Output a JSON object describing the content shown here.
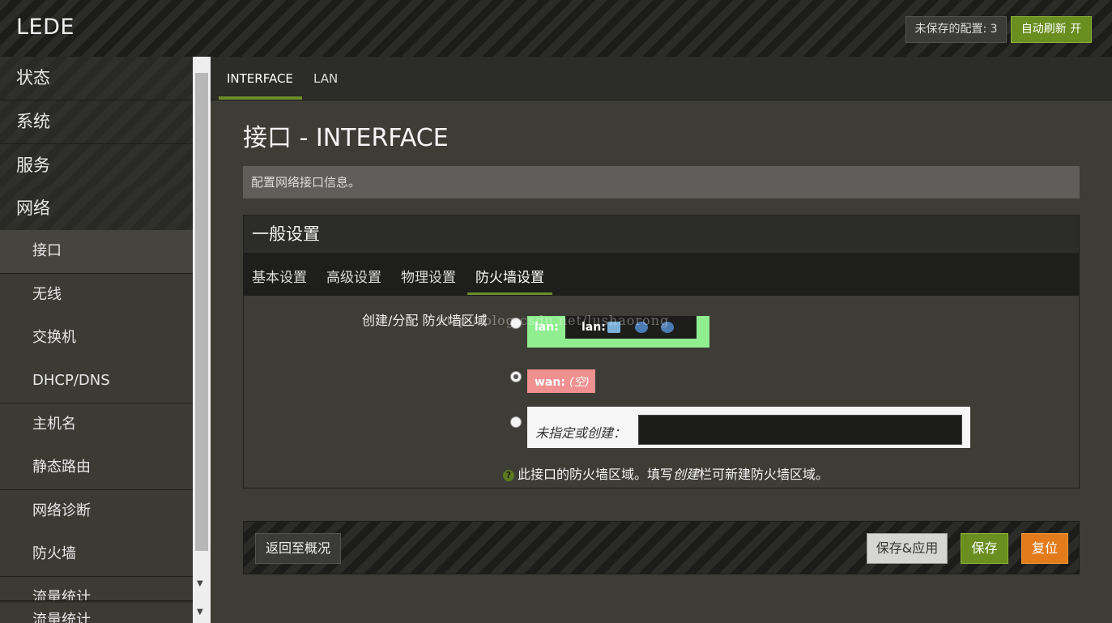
{
  "header": {
    "brand": "LEDE",
    "unsaved_label": "未保存的配置: 3",
    "autorefresh_label": "自动刷新 开"
  },
  "sidebar": {
    "items": [
      {
        "label": "状态",
        "level": "top"
      },
      {
        "label": "系统",
        "level": "top"
      },
      {
        "label": "服务",
        "level": "top"
      },
      {
        "label": "网络",
        "level": "top"
      },
      {
        "label": "接口",
        "level": "sub",
        "active": true
      },
      {
        "label": "无线",
        "level": "sub"
      },
      {
        "label": "交换机",
        "level": "sub"
      },
      {
        "label": "DHCP/DNS",
        "level": "sub"
      },
      {
        "label": "主机名",
        "level": "sub"
      },
      {
        "label": "静态路由",
        "level": "sub"
      },
      {
        "label": "网络诊断",
        "level": "sub"
      },
      {
        "label": "防火墙",
        "level": "sub"
      },
      {
        "label": "流量统计",
        "level": "sub"
      },
      {
        "label": "流量统计",
        "level": "sub"
      }
    ]
  },
  "tabs": [
    {
      "label": "INTERFACE",
      "active": true
    },
    {
      "label": "LAN",
      "active": false
    }
  ],
  "page": {
    "title": "接口 - INTERFACE",
    "description": "配置网络接口信息。"
  },
  "section": {
    "title": "一般设置",
    "subtabs": [
      {
        "label": "基本设置",
        "active": false
      },
      {
        "label": "高级设置",
        "active": false
      },
      {
        "label": "物理设置",
        "active": false
      },
      {
        "label": "防火墙设置",
        "active": true
      }
    ],
    "field_label": "创建/分配 防火墙区域",
    "options": {
      "lan": {
        "name": "lan:",
        "inner_name": "lan:",
        "color": "#90ee90",
        "icons": [
          "network-adapter-icon",
          "wifi-icon",
          "wifi-icon"
        ],
        "checked": false
      },
      "wan": {
        "name": "wan:",
        "detail": "(空)",
        "color": "#f09090",
        "checked": true
      },
      "new": {
        "label": "未指定或创建：",
        "value": "",
        "checked": false
      }
    },
    "help_text": "此接口的防火墙区域。填写",
    "help_em": "创建",
    "help_text2": "栏可新建防火墙区域。"
  },
  "watermark": "http://blog.csdn.net/lushaorong",
  "footer": {
    "back_label": "返回至概况",
    "save_apply_label": "保存&应用",
    "save_label": "保存",
    "reset_label": "复位"
  }
}
